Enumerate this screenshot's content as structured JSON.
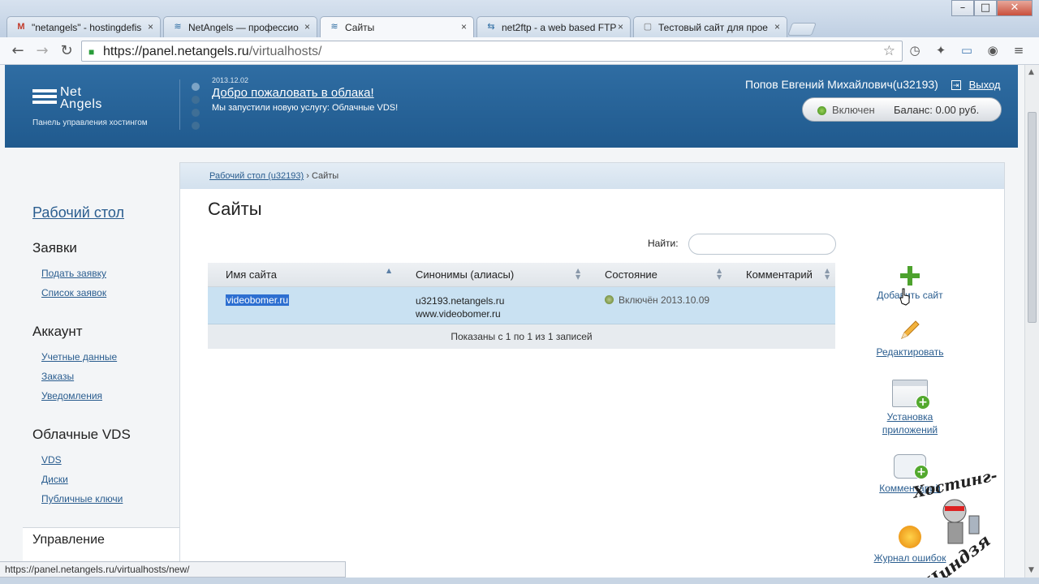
{
  "browser": {
    "window_controls": {
      "minimize": "–",
      "maximize": "□",
      "close": "✕"
    },
    "tabs": [
      {
        "icon": "M",
        "title": "\"netangels\" - hostingdefis",
        "active": false
      },
      {
        "icon": "≋",
        "title": "NetAngels — профессио",
        "active": false
      },
      {
        "icon": "≋",
        "title": "Сайты",
        "active": true
      },
      {
        "icon": "⇆",
        "title": "net2ftp - a web based FTP",
        "active": false
      },
      {
        "icon": "▢",
        "title": "Тестовый сайт для прое",
        "active": false
      }
    ],
    "tab_close": "×",
    "url_host": "https://panel.netangels.ru",
    "url_path": "/virtualhosts/",
    "status_link": "https://panel.netangels.ru/virtualhosts/new/"
  },
  "header": {
    "logo_line1": "Net",
    "logo_line2": "Angels",
    "logo_tagline": "Панель управления хостингом",
    "news_date": "2013.12.02",
    "news_title": "Добро пожаловать в облака!",
    "news_text": "Мы запустили новую услугу: Облачные VDS!",
    "user_name": "Попов Евгений Михайлович(u32193)",
    "logout": "Выход",
    "status": "Включен",
    "balance": "Баланс: 0.00 руб."
  },
  "sidebar": {
    "home": "Рабочий стол",
    "groups": [
      {
        "title": "Заявки",
        "links": [
          "Подать заявку",
          "Список заявок"
        ]
      },
      {
        "title": "Аккаунт",
        "links": [
          "Учетные данные",
          "Заказы",
          "Уведомления"
        ]
      },
      {
        "title": "Облачные VDS",
        "links": [
          "VDS",
          "Диски",
          "Публичные ключи"
        ]
      }
    ],
    "bottom_group": "Управление"
  },
  "content": {
    "breadcrumb_link": "Рабочий стол (u32193)",
    "breadcrumb_sep": "›",
    "breadcrumb_current": "Сайты",
    "title": "Сайты",
    "search_label": "Найти:",
    "search_value": "",
    "columns": [
      "Имя сайта",
      "Синонимы (алиасы)",
      "Состояние",
      "Комментарий"
    ],
    "rows": [
      {
        "name": "videobomer.ru",
        "alias1": "u32193.netangels.ru",
        "alias2": "www.videobomer.ru",
        "state": "Включён 2013.10.09",
        "comment": ""
      }
    ],
    "footer": "Показаны с 1 по 1 из 1 записей"
  },
  "actions": [
    {
      "icon": "plus-icon",
      "label": "Добавить сайт"
    },
    {
      "icon": "pencil-icon",
      "label": "Редактировать"
    },
    {
      "icon": "app-install-icon",
      "label": "Установка приложений"
    },
    {
      "icon": "comment-icon",
      "label": "Комментарий"
    },
    {
      "icon": "bug-icon",
      "label": "Журнал ошибок"
    }
  ],
  "watermark": {
    "line1": "Хостинг-",
    "line2": "Ниндзя"
  },
  "colors": {
    "header_blue": "#2f6da3",
    "link": "#2a5d8f",
    "row_selected": "#c9e1f2",
    "status_green": "#3d8a18"
  }
}
